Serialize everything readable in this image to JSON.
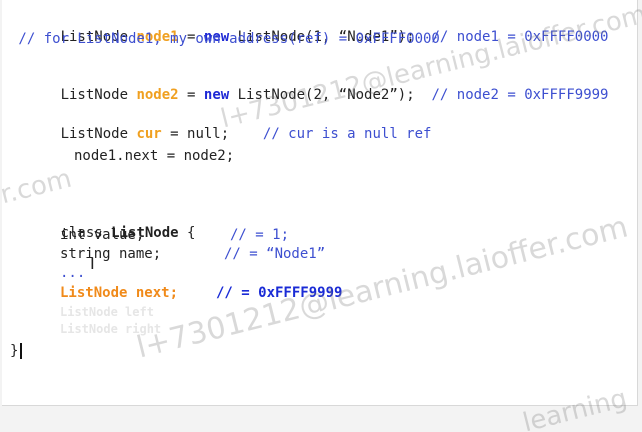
{
  "code": {
    "l1": {
      "type": "ListNode ",
      "var": "node1",
      "eq": " = ",
      "kw": "new",
      "rest": " ListNode(1, “Node1”);  ",
      "comment": "// node1 = 0xFFFF0000"
    },
    "l2": " // for ListNode1, my own address(ref) = 0xFFFF0000",
    "l3": {
      "type": "ListNode ",
      "var": "node2",
      "eq": " = ",
      "kw": "new",
      "rest": " ListNode(2, “Node2”);  ",
      "comment": "// node2 = 0xFFFF9999"
    },
    "l4": {
      "type": "ListNode ",
      "var": "cur",
      "rest": " = null;    ",
      "comment": "// cur is a null ref"
    },
    "l5": "node1.next = node2;",
    "l6": {
      "kw": "class ",
      "name": "ListNode",
      "rest": " {"
    },
    "l7": {
      "code": "int value;",
      "comment": "// = 1;"
    },
    "l8": {
      "code": "string name;",
      "comment": "// = “Node1”"
    },
    "l9": "...",
    "l10": {
      "code": "ListNode next;",
      "comment": "// = 0xFFFF9999"
    },
    "ghost1": "ListNode left",
    "ghost2": "ListNode right",
    "l11": "}"
  },
  "watermarks": {
    "w1": "l+7301212@learning.laioffer.com",
    "w2": "l+7301212@learning.laioffer.com",
    "w3": "learning",
    "w4": "r.com"
  },
  "colors": {
    "keyword": "#1f2ad6",
    "variable": "#f0a020",
    "comment": "#3d4fd0",
    "highlight_orange": "#f08a1a"
  }
}
